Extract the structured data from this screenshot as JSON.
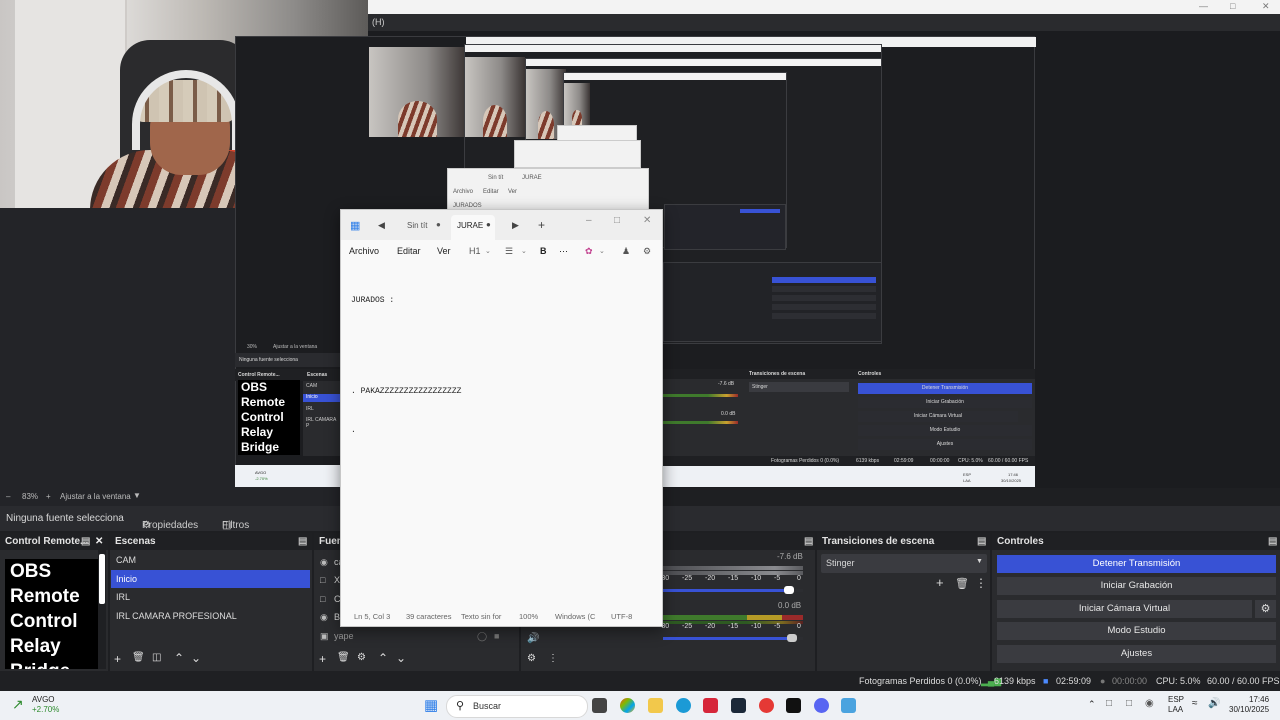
{
  "window": {
    "title_fragment": "(H)"
  },
  "preview": {
    "zoom": "83%",
    "fit_label": "Ajustar a la ventana"
  },
  "nested_preview": {
    "zoom": "30%",
    "fit_label": "Ajustar a la ventana",
    "no_source": "Ninguna fuente selecciona",
    "dock_control": "Control Remote...",
    "dock_scenes": "Escenas",
    "scenes": [
      "CAM",
      "Inicio",
      "IRL",
      "IRL CAMARA P"
    ],
    "obs_text": "OBS Remote Control Relay Bridge",
    "transitions_title": "Transiciones de escena",
    "transition": "Stinger",
    "controls_title": "Controles",
    "controls": [
      "Detener Transmisión",
      "Iniciar Grabación",
      "Iniciar Cámara Virtual",
      "Modo Estudio",
      "Ajustes"
    ],
    "status": [
      "Fotogramas Perdidos 0 (0.0%)",
      "6139 kbps",
      "02:59:09",
      "00:00:00",
      "CPU: 5.0%",
      "60.00 / 60.00 FPS"
    ],
    "level1": "-7.6 dB",
    "level2": "0.0 dB",
    "stock": "AVGO",
    "stock_change": "-2.70%",
    "tray": [
      "ESP",
      "LAA",
      "17:46",
      "30/10/2025"
    ],
    "notepad_menu": [
      "Archivo",
      "Editar",
      "Ver"
    ],
    "notepad_tabs": [
      "Sin tít",
      "JURAE"
    ],
    "notepad_text": "JURADOS"
  },
  "source_bar": {
    "no_source": "Ninguna fuente selecciona",
    "properties": "Propiedades",
    "filters": "Filtros"
  },
  "docks": {
    "control_title": "Control Remote...",
    "obs_text": [
      "OBS",
      "Remote",
      "Control",
      "Relay",
      "Bridge"
    ],
    "scenes_title": "Escenas",
    "scenes": [
      {
        "label": "CAM",
        "selected": false
      },
      {
        "label": "Inicio",
        "selected": true
      },
      {
        "label": "IRL",
        "selected": false
      },
      {
        "label": "IRL CAMARA PROFESIONAL",
        "selected": false
      }
    ],
    "sources_title": "Fuent",
    "sources_partial": [
      "ca",
      "X",
      "C",
      "B"
    ],
    "source_last": "yape",
    "transitions_title": "Transiciones de escena",
    "transition_selected": "Stinger",
    "controls_title": "Controles",
    "controls": [
      "Detener Transmisión",
      "Iniciar Grabación",
      "Iniciar Cámara Virtual",
      "Modo Estudio",
      "Ajustes"
    ]
  },
  "mixer": {
    "ticks": [
      "-30",
      "-25",
      "-20",
      "-15",
      "-10",
      "-5",
      "0"
    ],
    "track1_db": "-7.6 dB",
    "track2_db": "0.0 dB",
    "track1_level": 0.9,
    "track2_level": 0.92
  },
  "status": {
    "dropped": "Fotogramas Perdidos 0 (0.0%)",
    "bitrate": "6139 kbps",
    "stream_time": "02:59:09",
    "rec_time": "00:00:00",
    "cpu": "CPU: 5.0%",
    "fps": "60.00 / 60.00 FPS"
  },
  "notepad": {
    "tabs": [
      "Sin tít",
      "JURAE"
    ],
    "menu": [
      "Archivo",
      "Editar",
      "Ver",
      "H1"
    ],
    "lines": [
      "JURADOS :",
      "",
      "",
      ". PAKAZZZZZZZZZZZZZZZZZ",
      "."
    ],
    "footer": [
      "Ln 5, Col 3",
      "39 caracteres",
      "Texto sin for",
      "100%",
      "Windows (C",
      "UTF-8"
    ]
  },
  "taskbar": {
    "stock": "AVGO",
    "stock_change": "+2.70%",
    "search": "Buscar",
    "lang1": "ESP",
    "lang2": "LAA",
    "time": "17:46",
    "date": "30/10/2025"
  },
  "colors": {
    "accent": "#3852d5",
    "obs_bg": "#2a2b2e",
    "dock_hdr": "#1f2023",
    "taskbar": "#eef1f5"
  }
}
